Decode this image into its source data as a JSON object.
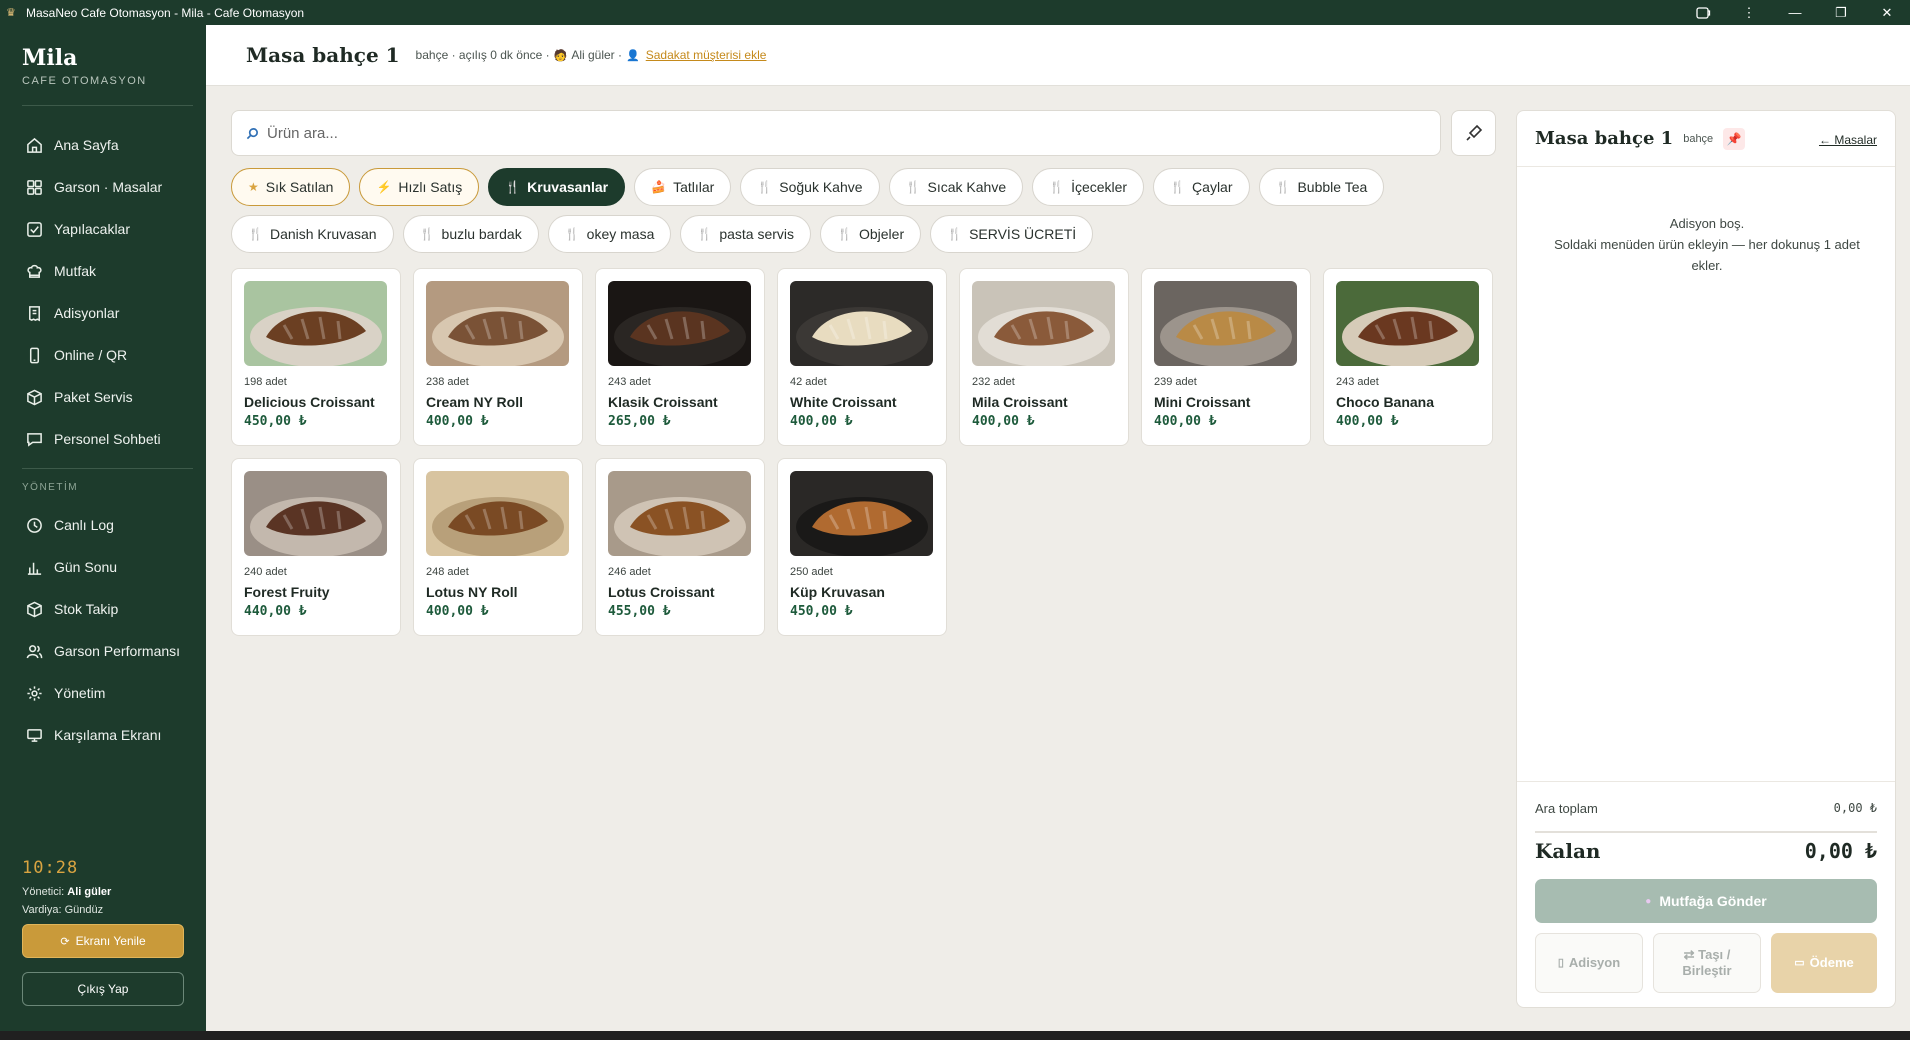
{
  "window": {
    "title": "MasaNeo Cafe Otomasyon - Mila - Cafe Otomasyon"
  },
  "sidebar": {
    "brand": "Mila",
    "brand_sub": "CAFE OTOMASYON",
    "items": [
      {
        "label": "Ana Sayfa",
        "icon": "home-icon"
      },
      {
        "label": "Garson · Masalar",
        "icon": "grid-icon"
      },
      {
        "label": "Yapılacaklar",
        "icon": "checkbox-icon"
      },
      {
        "label": "Mutfak",
        "icon": "chef-hat-icon"
      },
      {
        "label": "Adisyonlar",
        "icon": "receipt-icon"
      },
      {
        "label": "Online / QR",
        "icon": "phone-icon"
      },
      {
        "label": "Paket Servis",
        "icon": "package-icon"
      },
      {
        "label": "Personel Sohbeti",
        "icon": "chat-icon"
      }
    ],
    "section_label": "YÖNETİM",
    "admin_items": [
      {
        "label": "Canlı Log",
        "icon": "clock-icon"
      },
      {
        "label": "Gün Sonu",
        "icon": "bar-chart-icon"
      },
      {
        "label": "Stok Takip",
        "icon": "box-icon"
      },
      {
        "label": "Garson Performansı",
        "icon": "users-icon"
      },
      {
        "label": "Yönetim",
        "icon": "gear-icon"
      },
      {
        "label": "Karşılama Ekranı",
        "icon": "monitor-icon"
      }
    ],
    "clock": "10:28",
    "manager_label": "Yönetici:",
    "manager_name": "Ali güler",
    "shift": "Vardiya: Gündüz",
    "refresh_label": "Ekranı Yenile",
    "logout_label": "Çıkış Yap"
  },
  "header": {
    "table_name": "Masa bahçe 1",
    "meta": "bahçe · açılış 0 dk önce ·",
    "waiter": "Ali güler ·",
    "loyalty_link": "Sadakat müşterisi ekle"
  },
  "search": {
    "placeholder": "Ürün ara..."
  },
  "categories": {
    "row1": [
      {
        "label": "Sık Satılan",
        "icon": "★",
        "style": "gold"
      },
      {
        "label": "Hızlı Satış",
        "icon": "⚡",
        "style": "gold"
      },
      {
        "label": "Kruvasanlar",
        "icon": "🍴",
        "style": "active"
      },
      {
        "label": "Tatlılar",
        "icon": "🍰",
        "style": ""
      },
      {
        "label": "Soğuk Kahve",
        "icon": "🍴",
        "style": ""
      },
      {
        "label": "Sıcak Kahve",
        "icon": "🍴",
        "style": ""
      },
      {
        "label": "İçecekler",
        "icon": "🍴",
        "style": ""
      },
      {
        "label": "Çaylar",
        "icon": "🍴",
        "style": ""
      },
      {
        "label": "Bubble Tea",
        "icon": "🍴",
        "style": ""
      }
    ],
    "row2": [
      {
        "label": "Danish Kruvasan",
        "icon": "🍴",
        "style": ""
      },
      {
        "label": "buzlu bardak",
        "icon": "🍴",
        "style": ""
      },
      {
        "label": "okey masa",
        "icon": "🍴",
        "style": ""
      },
      {
        "label": "pasta servis",
        "icon": "🍴",
        "style": ""
      },
      {
        "label": "Objeler",
        "icon": "🍴",
        "style": ""
      },
      {
        "label": "SERVİS ÜCRETİ",
        "icon": "🍴",
        "style": ""
      }
    ]
  },
  "products": [
    {
      "stock": "198 adet",
      "name": "Delicious Croissant",
      "price": "450,00 ₺",
      "bg": "#a9c4a0",
      "food": "#6b3f22",
      "plate": "#d9d2c6"
    },
    {
      "stock": "238 adet",
      "name": "Cream NY Roll",
      "price": "400,00 ₺",
      "bg": "#b49a80",
      "food": "#7a5236",
      "plate": "#d8c7b0"
    },
    {
      "stock": "243 adet",
      "name": "Klasik Croissant",
      "price": "265,00 ₺",
      "bg": "#1a1614",
      "food": "#5a3420",
      "plate": "#2a2623"
    },
    {
      "stock": "42 adet",
      "name": "White Croissant",
      "price": "400,00 ₺",
      "bg": "#2c2a28",
      "food": "#e8dcc0",
      "plate": "#3b3835"
    },
    {
      "stock": "232 adet",
      "name": "Mila Croissant",
      "price": "400,00 ₺",
      "bg": "#c9c3b8",
      "food": "#8a5a3a",
      "plate": "#e2ddd5"
    },
    {
      "stock": "239 adet",
      "name": "Mini Croissant",
      "price": "400,00 ₺",
      "bg": "#6b6560",
      "food": "#b98a46",
      "plate": "#9c948c"
    },
    {
      "stock": "243 adet",
      "name": "Choco Banana",
      "price": "400,00 ₺",
      "bg": "#4b6a3a",
      "food": "#6a3820",
      "plate": "#d6cbb8"
    },
    {
      "stock": "240 adet",
      "name": "Forest Fruity",
      "price": "440,00 ₺",
      "bg": "#9a8f86",
      "food": "#5a3424",
      "plate": "#c3b8ad"
    },
    {
      "stock": "248 adet",
      "name": "Lotus NY Roll",
      "price": "400,00 ₺",
      "bg": "#d8c4a0",
      "food": "#7a4a24",
      "plate": "#b8a07a"
    },
    {
      "stock": "246 adet",
      "name": "Lotus Croissant",
      "price": "455,00 ₺",
      "bg": "#a89a8a",
      "food": "#8a5224",
      "plate": "#cfc3b4"
    },
    {
      "stock": "250 adet",
      "name": "Küp Kruvasan",
      "price": "450,00 ₺",
      "bg": "#2a2826",
      "food": "#b06a30",
      "plate": "#1a1918"
    }
  ],
  "order": {
    "title": "Masa bahçe 1",
    "zone": "bahçe",
    "back_label": "← Masalar",
    "empty_line1": "Adisyon boş.",
    "empty_line2": "Soldaki menüden ürün ekleyin — her dokunuş 1 adet ekler.",
    "subtotal_label": "Ara toplam",
    "subtotal_value": "0,00 ₺",
    "remaining_label": "Kalan",
    "remaining_value": "0,00 ₺",
    "kitchen_label": "Mutfağa Gönder",
    "receipt_label": "Adisyon",
    "move_label": "⇄ Taşı / Birleştir",
    "payment_label": "Ödeme"
  },
  "colors": {
    "primary": "#1d3b2c",
    "accent": "#c99a3a",
    "price": "#1d5a3b"
  }
}
